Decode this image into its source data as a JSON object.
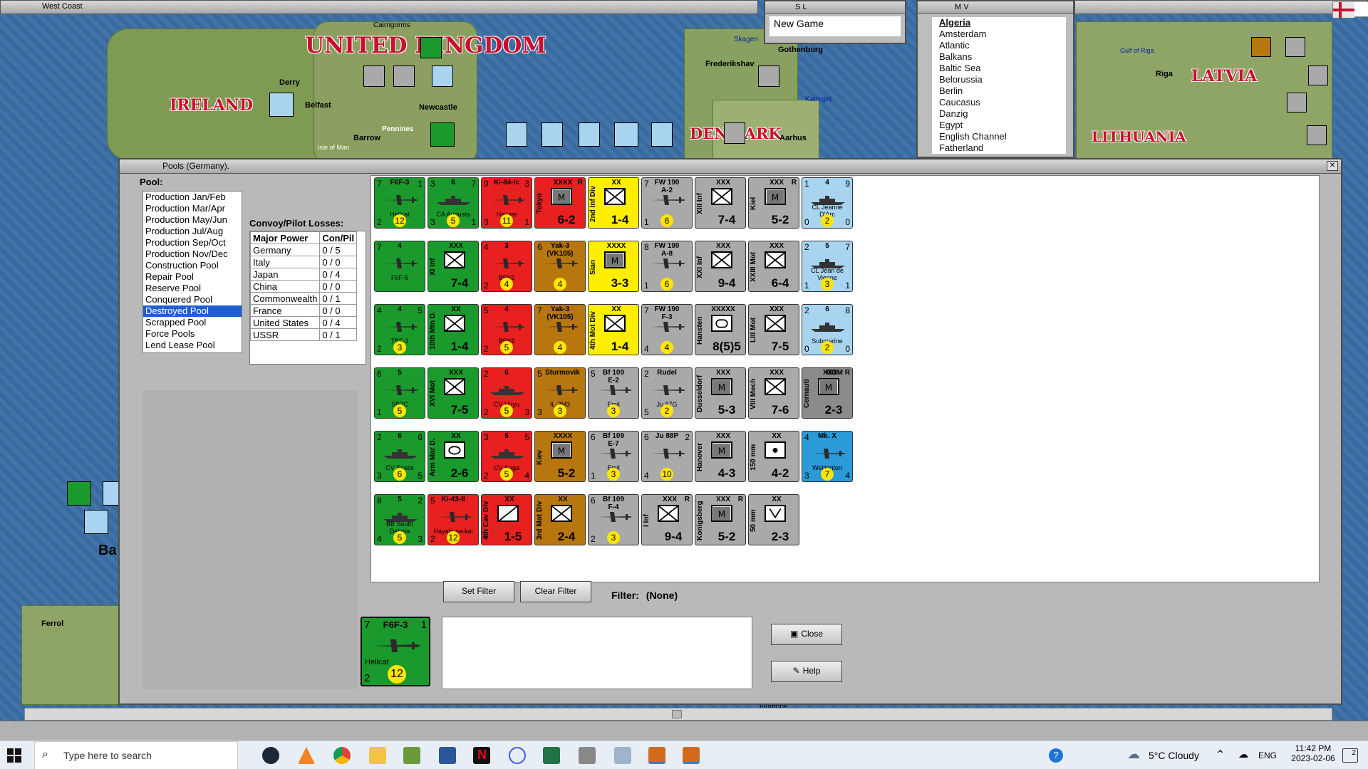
{
  "top_bars": {
    "map_title": "West Coast",
    "sl_title": "S L",
    "sl_item": "New Game",
    "mv_title": "M V"
  },
  "sea_areas": [
    "Algeria",
    "Amsterdam",
    "Atlantic",
    "Balkans",
    "Baltic Sea",
    "Belorussia",
    "Berlin",
    "Caucasus",
    "Danzig",
    "Egypt",
    "English Channel",
    "Fatherland"
  ],
  "map_labels": {
    "uk": "UNITED KINGDOM",
    "ireland": "IRELAND",
    "denmark": "DENMARK",
    "latvia": "LATVIA",
    "lithuania": "LITHUANIA",
    "derry": "Derry",
    "belfast": "Belfast",
    "barrow": "Barrow",
    "newcastle": "Newcastle",
    "pennines": "Pennines",
    "isle_of_man": "Isle of Man",
    "frederikshavn": "Frederikshav",
    "gothenburg": "Gothenburg",
    "kattegat": "Kattegat",
    "aarhus": "Aarhus",
    "riga": "Riga",
    "gulf_of_riga": "Gulf of Riga",
    "ferrol": "Ferrol",
    "skagen": "Skagen",
    "cairngorms": "Cairngorms",
    "ba": "Ba",
    "florence": "Florence"
  },
  "pools_window": {
    "title": "Pools (Germany).",
    "pool_label": "Pool:",
    "pool_items": [
      {
        "label": "Production Jan/Feb",
        "selected": false
      },
      {
        "label": "Production Mar/Apr",
        "selected": false
      },
      {
        "label": "Production May/Jun",
        "selected": false
      },
      {
        "label": "Production Jul/Aug",
        "selected": false
      },
      {
        "label": "Production Sep/Oct",
        "selected": false
      },
      {
        "label": "Production Nov/Dec",
        "selected": false
      },
      {
        "label": "Construction Pool",
        "selected": false
      },
      {
        "label": "Repair Pool",
        "selected": false
      },
      {
        "label": "Reserve Pool",
        "selected": false
      },
      {
        "label": "Conquered Pool",
        "selected": false
      },
      {
        "label": "Destroyed Pool",
        "selected": true
      },
      {
        "label": "Scrapped Pool",
        "selected": false
      },
      {
        "label": "Force Pools",
        "selected": false
      },
      {
        "label": "Lend Lease Pool",
        "selected": false
      }
    ],
    "convoy_title": "Convoy/Pilot Losses:",
    "convoy_headers": [
      "Major Power",
      "Con/Pil"
    ],
    "convoy_rows": [
      [
        "Germany",
        "0 / 5"
      ],
      [
        "Italy",
        "0 / 0"
      ],
      [
        "Japan",
        "0 / 4"
      ],
      [
        "China",
        "0 / 0"
      ],
      [
        "Commonwealth",
        "0 / 1"
      ],
      [
        "France",
        "0 / 0"
      ],
      [
        "United States",
        "0 / 4"
      ],
      [
        "USSR",
        "0 / 1"
      ]
    ],
    "set_filter": "Set Filter",
    "clear_filter": "Clear Filter",
    "filter_label": "Filter:",
    "filter_value": "(None)",
    "close": "Close",
    "help": "Help",
    "selected_counter": {
      "name": "F6F-3",
      "caption": "Hellcat",
      "tl": "7",
      "tr": "1",
      "bl": "2",
      "br": "12"
    }
  },
  "counters": [
    {
      "color": "green",
      "kind": "air",
      "name": "F6F-3",
      "caption": "Hellcat",
      "tl": "7",
      "tr": "1",
      "bl": "2",
      "br": "12"
    },
    {
      "color": "green",
      "kind": "ship",
      "name": "6",
      "caption": "CA Augusta",
      "tl": "3",
      "tr": "7",
      "bl": "3",
      "br": "1",
      "mid": "5"
    },
    {
      "color": "red",
      "kind": "air",
      "name": "Ki-84-Ic",
      "caption": "Hayate",
      "tl": "9",
      "tr": "3",
      "bl": "3",
      "br": "1",
      "mid": "11"
    },
    {
      "color": "red",
      "kind": "land",
      "side": "Tokyo",
      "size": "XXXX",
      "strength": "6-2",
      "sym": "M",
      "tag": "R"
    },
    {
      "color": "yellow",
      "kind": "land",
      "side": "2nd Inf Div",
      "size": "XX",
      "strength": "1-4",
      "sym": "X"
    },
    {
      "color": "gray",
      "kind": "air",
      "name": "FW 190 A-2",
      "caption": "",
      "tl": "7",
      "tr": "",
      "bl": "1",
      "br": "6"
    },
    {
      "color": "gray",
      "kind": "land",
      "side": "XIII Inf",
      "size": "XXX",
      "strength": "7-4",
      "sym": "X"
    },
    {
      "color": "gray",
      "kind": "land",
      "side": "Kiel",
      "size": "XXX",
      "strength": "5-2",
      "sym": "M",
      "tag": "R"
    },
    {
      "color": "lblue",
      "kind": "ship",
      "name": "4",
      "caption": "CL Jeanne D'Arc",
      "tl": "1",
      "tr": "9",
      "bl": "0",
      "br": "0",
      "mid": "2"
    },
    {
      "color": "green",
      "kind": "air",
      "name": "4",
      "caption": "F6F-5",
      "tl": "7",
      "tr": "",
      "bl": "",
      "br": ""
    },
    {
      "color": "green",
      "kind": "land",
      "side": "XI Inf",
      "size": "XXX",
      "strength": "7-4",
      "sym": "X"
    },
    {
      "color": "red",
      "kind": "air",
      "name": "3",
      "caption": "B5N2",
      "tl": "4",
      "tr": "",
      "bl": "2",
      "br": "4"
    },
    {
      "color": "brown",
      "kind": "air",
      "name": "Yak-3 (VK105)",
      "caption": "",
      "tl": "6",
      "tr": "",
      "bl": "",
      "br": "4"
    },
    {
      "color": "yellow",
      "kind": "land",
      "side": "Sian",
      "size": "XXXX",
      "strength": "3-3",
      "sym": "M"
    },
    {
      "color": "gray",
      "kind": "air",
      "name": "FW 190 A-8",
      "caption": "",
      "tl": "8",
      "tr": "",
      "bl": "1",
      "br": "6"
    },
    {
      "color": "gray",
      "kind": "land",
      "side": "XXI Inf",
      "size": "XXX",
      "strength": "9-4",
      "sym": "X"
    },
    {
      "color": "gray",
      "kind": "land",
      "side": "XXIII Mot",
      "size": "XXX",
      "strength": "6-4",
      "sym": "X"
    },
    {
      "color": "lblue",
      "kind": "ship",
      "name": "5",
      "caption": "CL Jean de Vienne",
      "tl": "2",
      "tr": "7",
      "bl": "1",
      "br": "1",
      "mid": "3"
    },
    {
      "color": "green",
      "kind": "air",
      "name": "4",
      "caption": "TBF-3",
      "tl": "4",
      "tr": "5",
      "bl": "2",
      "br": "3"
    },
    {
      "color": "green",
      "kind": "land",
      "side": "10th Mtn D.",
      "size": "XX",
      "strength": "1-4",
      "sym": "X"
    },
    {
      "color": "red",
      "kind": "air",
      "name": "4",
      "caption": "B5N2",
      "tl": "5",
      "tr": "",
      "bl": "2",
      "br": "5"
    },
    {
      "color": "brown",
      "kind": "air",
      "name": "Yak-3 (VK105)",
      "caption": "",
      "tl": "7",
      "tr": "",
      "bl": "",
      "br": "4"
    },
    {
      "color": "yellow",
      "kind": "land",
      "side": "4th Mot Div",
      "size": "XX",
      "strength": "1-4",
      "sym": "X"
    },
    {
      "color": "gray",
      "kind": "air",
      "name": "FW 190 F-3",
      "caption": "",
      "tl": "7",
      "tr": "",
      "bl": "4",
      "br": "4"
    },
    {
      "color": "gray",
      "kind": "land",
      "side": "Hansten",
      "size": "XXXXX",
      "strength": "8(5)5",
      "sym": "O"
    },
    {
      "color": "gray",
      "kind": "land",
      "side": "LIII Mot",
      "size": "XXX",
      "strength": "7-5",
      "sym": "X"
    },
    {
      "color": "lblue",
      "kind": "ship",
      "name": "6",
      "caption": "Submarine",
      "tl": "2",
      "tr": "8",
      "bl": "0",
      "br": "0",
      "mid": "2"
    },
    {
      "color": "green",
      "kind": "air",
      "name": "5",
      "caption": "SB2C",
      "tl": "6",
      "tr": "",
      "bl": "1",
      "br": "5"
    },
    {
      "color": "green",
      "kind": "land",
      "side": "XVI Mot",
      "size": "XXX",
      "strength": "7-5",
      "sym": "X"
    },
    {
      "color": "red",
      "kind": "ship",
      "name": "6",
      "caption": "CV Hiryu",
      "tl": "2",
      "tr": "",
      "bl": "2",
      "br": "3",
      "mid": "5"
    },
    {
      "color": "brown",
      "kind": "air",
      "name": "Sturmovik",
      "caption": "IL-2M3",
      "tl": "5",
      "tr": "",
      "bl": "3",
      "br": "3"
    },
    {
      "color": "gray",
      "kind": "air",
      "name": "Bf 109 E-2",
      "caption": "Emil",
      "tl": "5",
      "tr": "",
      "bl": "",
      "br": "3"
    },
    {
      "color": "gray",
      "kind": "air",
      "name": "Rudel",
      "caption": "Ju 87G",
      "tl": "2",
      "tr": "",
      "bl": "5",
      "br": "2"
    },
    {
      "color": "gray",
      "kind": "land",
      "side": "Dusseldorf",
      "size": "XXX",
      "strength": "5-3",
      "sym": "M"
    },
    {
      "color": "gray",
      "kind": "land",
      "side": "VIII Mech",
      "size": "XXX",
      "strength": "7-6",
      "sym": "X"
    },
    {
      "color": "dgray",
      "kind": "land",
      "side": "Cernauti",
      "size": "XXX",
      "strength": "2-3",
      "sym": "M",
      "tag": "ROM R"
    },
    {
      "color": "green",
      "kind": "ship",
      "name": "6",
      "caption": "CV Essex",
      "tl": "2",
      "tr": "6",
      "bl": "3",
      "br": "5",
      "mid": "6"
    },
    {
      "color": "green",
      "kind": "land",
      "side": "Arm Mar D.",
      "size": "XX",
      "strength": "2-6",
      "sym": "A"
    },
    {
      "color": "red",
      "kind": "ship",
      "name": "5",
      "caption": "CV Kaga",
      "tl": "3",
      "tr": "5",
      "bl": "2",
      "br": "4",
      "mid": "5"
    },
    {
      "color": "brown",
      "kind": "land",
      "side": "Kiev",
      "size": "XXXX",
      "strength": "5-2",
      "sym": "M"
    },
    {
      "color": "gray",
      "kind": "air",
      "name": "Bf 109 E-7",
      "caption": "Emil",
      "tl": "6",
      "tr": "",
      "bl": "1",
      "br": "3"
    },
    {
      "color": "gray",
      "kind": "air",
      "name": "Ju 88P",
      "caption": "",
      "tl": "6",
      "tr": "2",
      "bl": "4",
      "br": "10"
    },
    {
      "color": "gray",
      "kind": "land",
      "side": "Hanover",
      "size": "XXX",
      "strength": "4-3",
      "sym": "M"
    },
    {
      "color": "gray",
      "kind": "land",
      "side": "150 mm",
      "size": "XX",
      "strength": "4-2",
      "sym": "D"
    },
    {
      "color": "blue",
      "kind": "air",
      "name": "Mk. X",
      "caption": "Wellington",
      "tl": "4",
      "tr": "",
      "bl": "3",
      "br": "4",
      "mid": "7"
    },
    {
      "color": "green",
      "kind": "ship",
      "name": "5",
      "caption": "BB South Dakota",
      "tl": "8",
      "tr": "2",
      "bl": "4",
      "br": "3",
      "mid": "5"
    },
    {
      "color": "red",
      "kind": "air",
      "name": "Ki-43-II",
      "caption": "Hayabusa-kai",
      "tl": "5",
      "tr": "",
      "bl": "2",
      "br": "12"
    },
    {
      "color": "red",
      "kind": "land",
      "side": "4th Cav Div",
      "size": "XX",
      "strength": "1-5",
      "sym": "C"
    },
    {
      "color": "brown",
      "kind": "land",
      "side": "3rd Mot Div",
      "size": "XX",
      "strength": "2-4",
      "sym": "X"
    },
    {
      "color": "gray",
      "kind": "air",
      "name": "Bf 109 F-4",
      "caption": "",
      "tl": "6",
      "tr": "",
      "bl": "2",
      "br": "3"
    },
    {
      "color": "gray",
      "kind": "land",
      "side": "I Inf",
      "size": "XXX",
      "strength": "9-4",
      "sym": "X",
      "tag": "R"
    },
    {
      "color": "gray",
      "kind": "land",
      "side": "Konigsberg",
      "size": "XXX",
      "strength": "5-2",
      "sym": "M",
      "tag": "R"
    },
    {
      "color": "gray",
      "kind": "land",
      "side": "50 mm",
      "size": "XX",
      "strength": "2-3",
      "sym": "V"
    }
  ],
  "taskbar": {
    "search_placeholder": "Type here to search",
    "weather": "5°C  Cloudy",
    "lang": "ENG",
    "time": "11:42 PM",
    "date": "2023-02-06",
    "notif": "2"
  }
}
